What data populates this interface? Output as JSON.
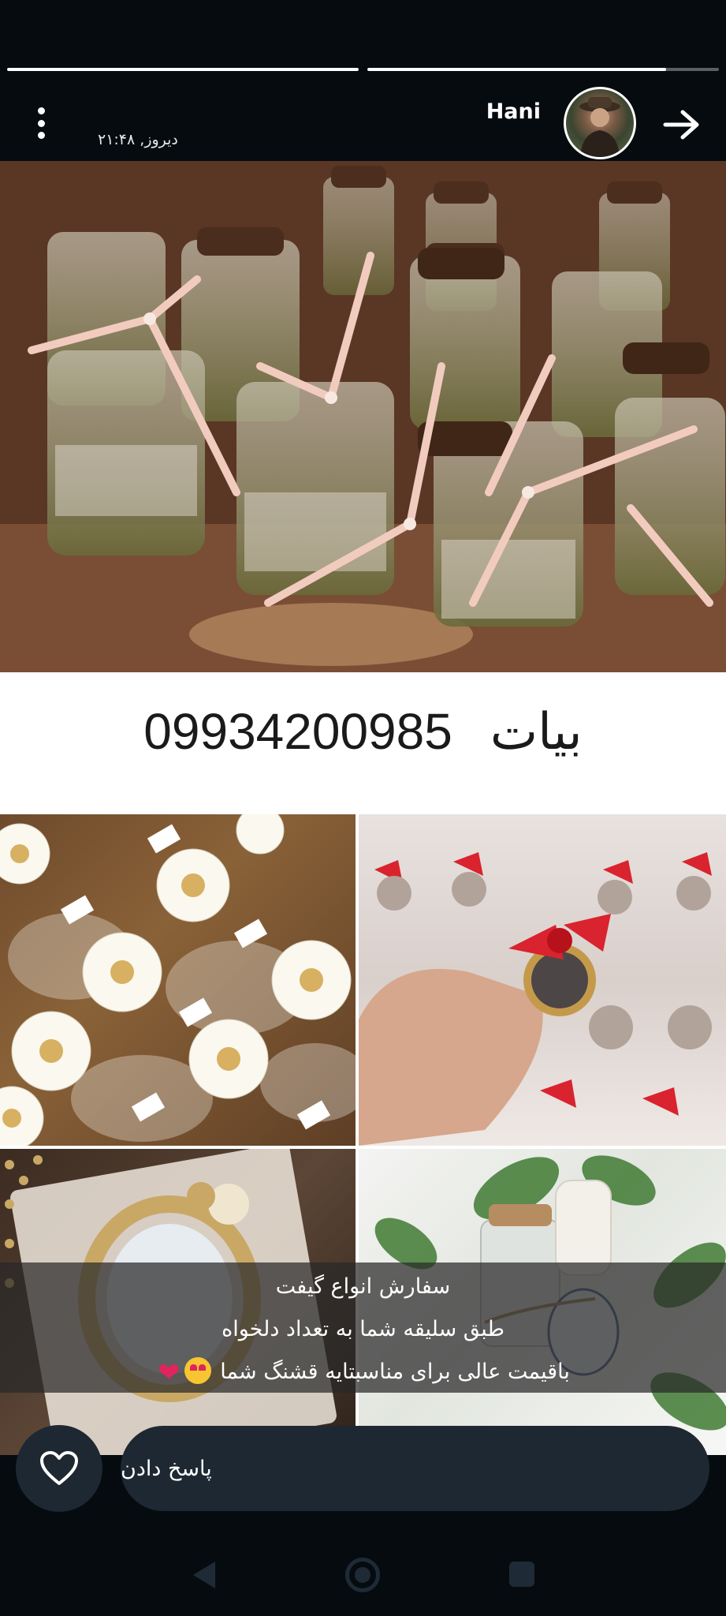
{
  "story": {
    "progress": [
      1.0,
      0.85,
      0.0
    ],
    "header": {
      "username": "Hani",
      "timestamp": "دیروز, ۲۱:۴۸"
    },
    "phone_banner": {
      "name": "بیات",
      "number": "09934200985"
    },
    "caption": {
      "line1": "سفارش انواع گیفت",
      "line2": "طبق سلیقه شما به تعداد دلخواه",
      "line3": "باقیمت عالی برای مناسبتایه قشنگ شما"
    },
    "reply": {
      "placeholder": "پاسخ دادن"
    }
  },
  "colors": {
    "background": "#060b10",
    "reply_bar": "#1d2833",
    "caption_overlay": "rgba(40,40,40,0.72)"
  }
}
